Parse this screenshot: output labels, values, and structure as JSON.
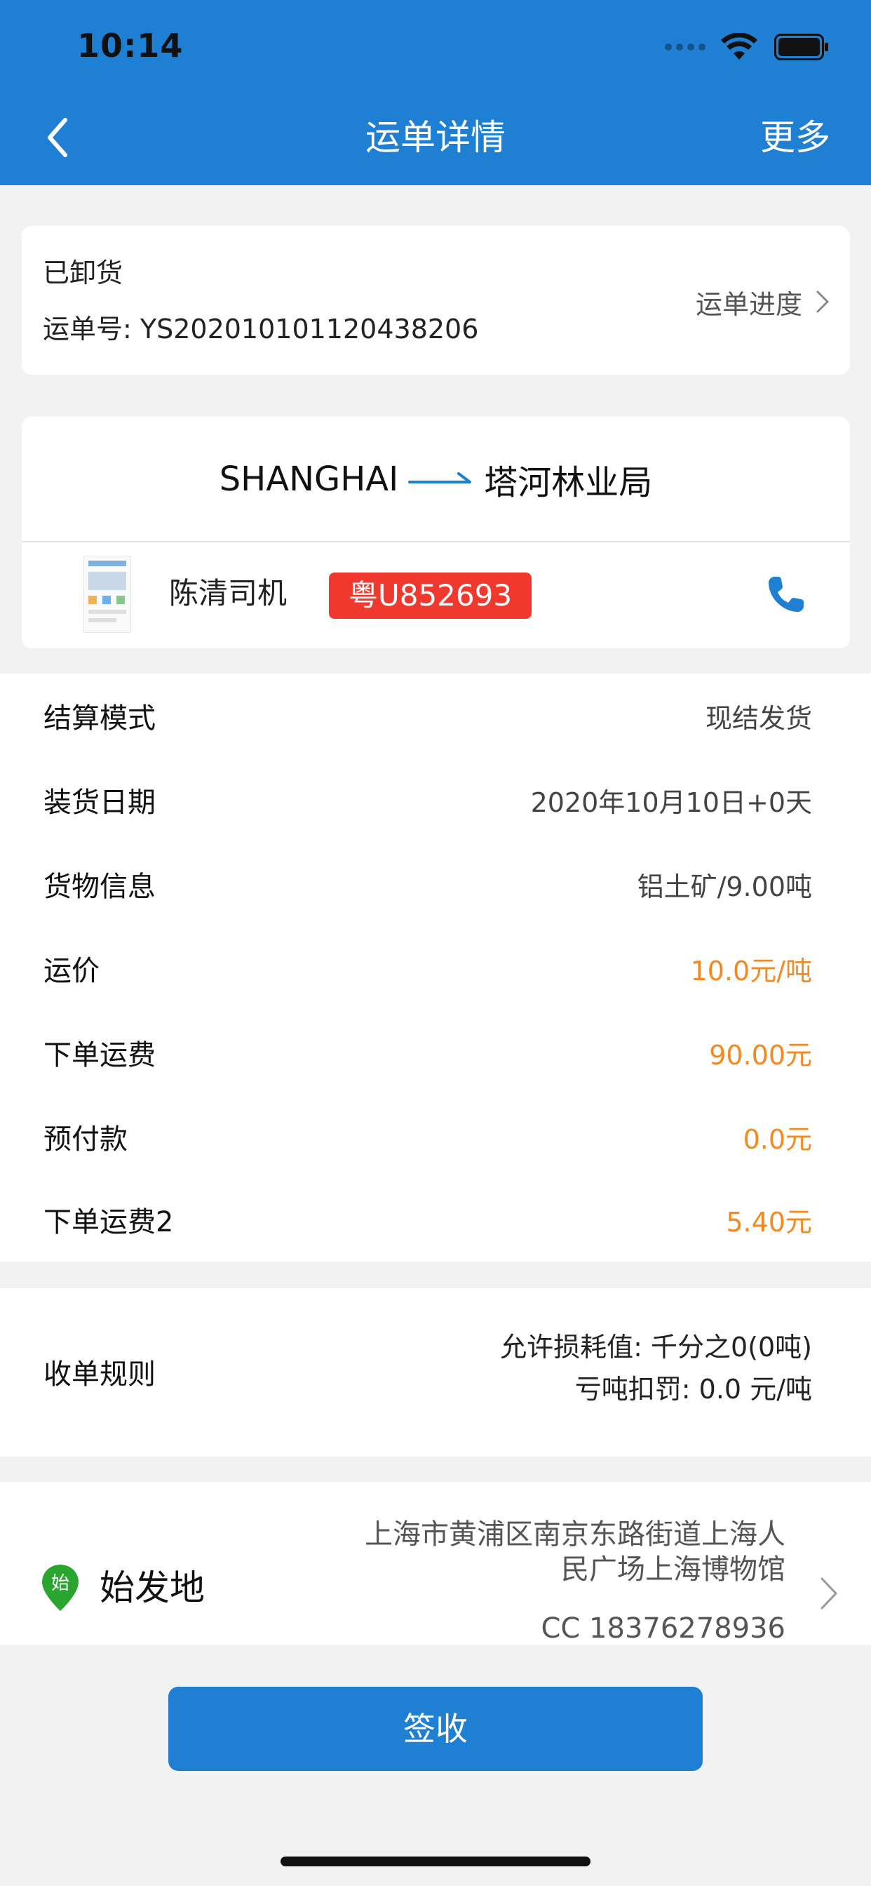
{
  "status_bar": {
    "time": "10:14"
  },
  "nav": {
    "title": "运单详情",
    "more_label": "更多"
  },
  "order": {
    "status": "已卸货",
    "waybill_number": "运单号: YS202010101120438206",
    "progress_label": "运单进度"
  },
  "route": {
    "origin": "SHANGHAI",
    "destination": "塔河林业局",
    "driver_name": "陈清司机",
    "plate_number": "粤U852693"
  },
  "info_rows": [
    {
      "label": "结算模式",
      "value": "现结发货"
    },
    {
      "label": "装货日期",
      "value": "2020年10月10日+0天"
    },
    {
      "label": "货物信息",
      "value": "铝土矿/9.00吨"
    },
    {
      "label": "运价",
      "value": "10.0元/吨"
    },
    {
      "label": "下单运费",
      "value": "90.00元"
    },
    {
      "label": "预付款",
      "value": "0.0元"
    },
    {
      "label": "下单运费2",
      "value": "5.40元"
    }
  ],
  "receipt_rule": {
    "label": "收单规则",
    "line1": "允许损耗值: 千分之0(0吨)",
    "line2": "亏吨扣罚: 0.0 元/吨"
  },
  "origin": {
    "pin_char": "始",
    "label": "始发地",
    "address": "上海市黄浦区南京东路街道上海人民广场上海博物馆",
    "contact": "CC 18376278936"
  },
  "actions": {
    "sign_label": "签收"
  },
  "colors": {
    "primary": "#1f7fd2",
    "price_orange": "#f5881f",
    "plate_red": "#f0382f",
    "pin_green": "#2aa52f"
  }
}
